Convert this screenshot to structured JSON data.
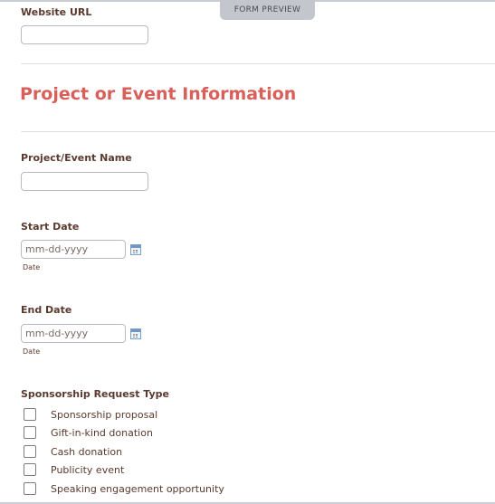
{
  "preview_tab": {
    "label": "FORM PREVIEW"
  },
  "website": {
    "label": "Website URL",
    "value": ""
  },
  "section": {
    "title": "Project or Event Information"
  },
  "project_name": {
    "label": "Project/Event Name",
    "value": ""
  },
  "start_date": {
    "label": "Start Date",
    "placeholder": "mm-dd-yyyy",
    "sublabel": "Date",
    "icon": "calendar-icon"
  },
  "end_date": {
    "label": "End Date",
    "placeholder": "mm-dd-yyyy",
    "sublabel": "Date",
    "icon": "calendar-icon"
  },
  "sponsorship": {
    "label": "Sponsorship Request Type",
    "options": [
      {
        "label": "Sponsorship proposal",
        "checked": false
      },
      {
        "label": "Gift-in-kind donation",
        "checked": false
      },
      {
        "label": "Cash donation",
        "checked": false
      },
      {
        "label": "Publicity event",
        "checked": false
      },
      {
        "label": "Speaking engagement opportunity",
        "checked": false
      }
    ]
  },
  "colors": {
    "section_title": "#d9605a",
    "label": "#5a3a2e",
    "tab_bg": "#c3c6cd"
  }
}
